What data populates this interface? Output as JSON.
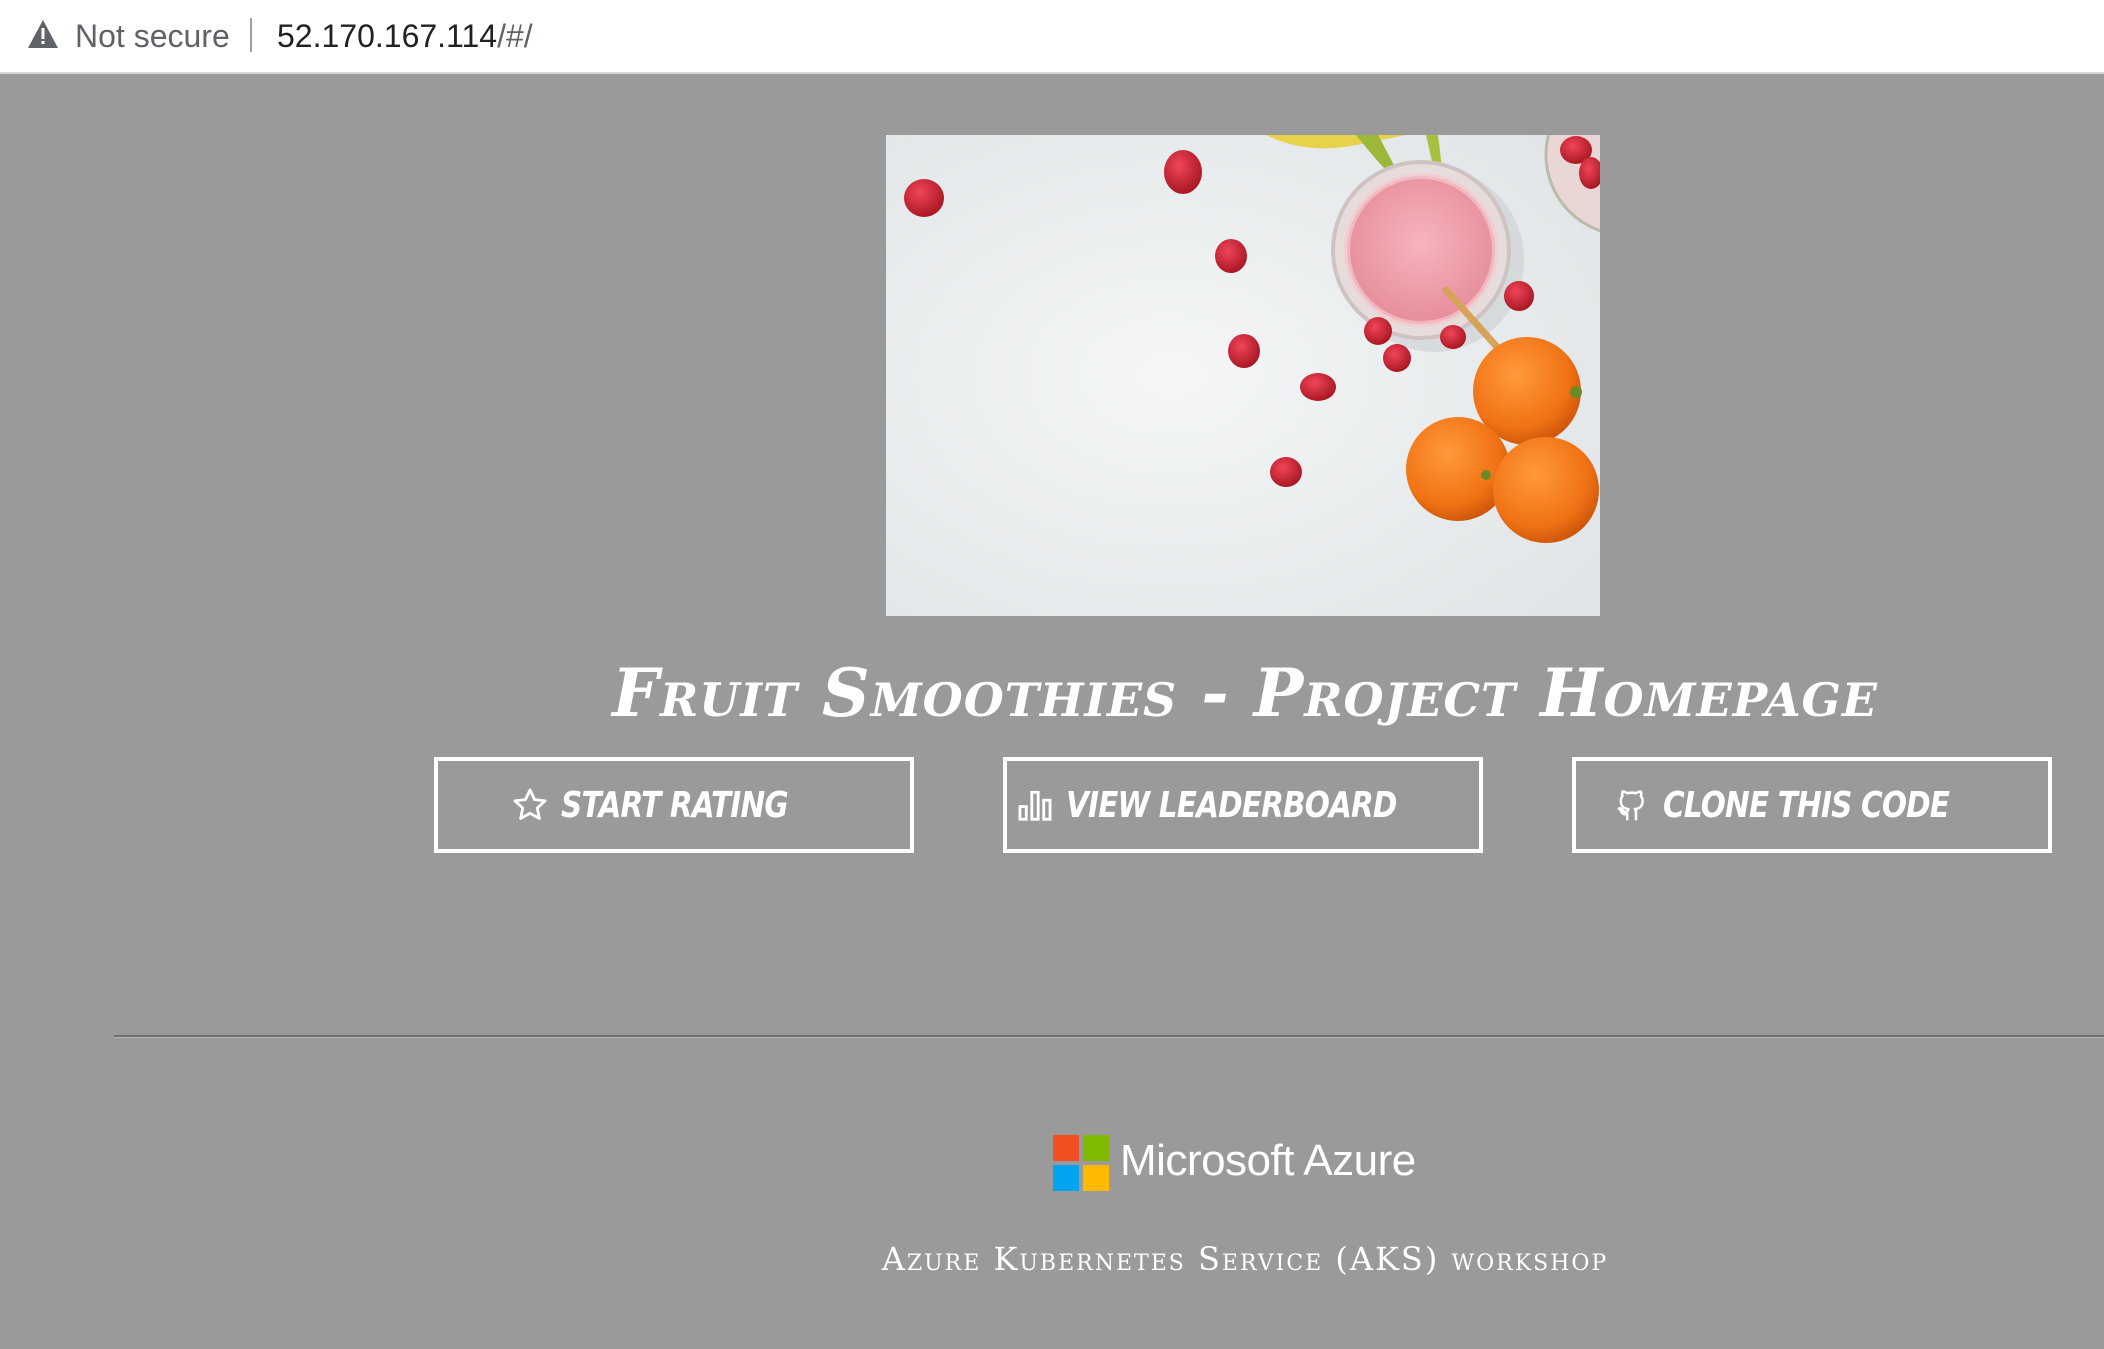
{
  "browser": {
    "security_label": "Not secure",
    "url_host": "52.170.167.114",
    "url_path": "/#/"
  },
  "hero": {
    "image_name": "fruit-smoothie-photo"
  },
  "page": {
    "title": "Fruit Smoothies - Project Homepage"
  },
  "actions": {
    "start_rating": {
      "label": "Start Rating",
      "icon": "star-icon"
    },
    "view_leaderboard": {
      "label": "View Leaderboard",
      "icon": "bar-chart-icon"
    },
    "clone_code": {
      "label": "Clone This Code",
      "icon": "github-icon"
    }
  },
  "footer": {
    "brand": "Microsoft Azure",
    "subtitle": "Azure Kubernetes Service (AKS) workshop",
    "logo_colors": [
      "#f25022",
      "#7fba00",
      "#00a4ef",
      "#ffb900"
    ]
  },
  "colors": {
    "background": "#9a9a9a",
    "text": "#ffffff"
  }
}
